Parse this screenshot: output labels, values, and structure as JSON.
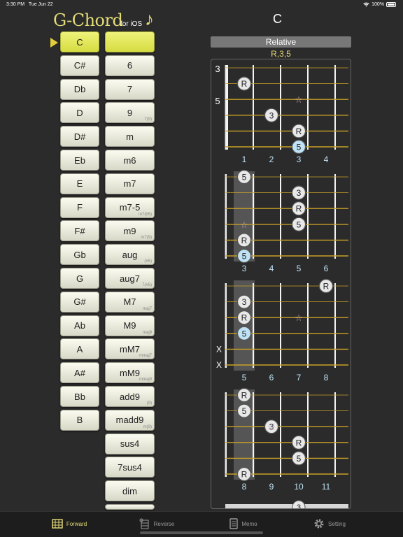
{
  "status_bar": {
    "time": "3:30 PM",
    "date": "Tue Jun 22",
    "battery": "100%"
  },
  "app": {
    "logo": "G-Chord",
    "logo_sub": "for iOS",
    "logo_note": "♪"
  },
  "selected_chord": "C",
  "roots": [
    "C",
    "C#",
    "Db",
    "D",
    "D#",
    "Eb",
    "E",
    "F",
    "F#",
    "Gb",
    "G",
    "G#",
    "Ab",
    "A",
    "A#",
    "Bb",
    "B"
  ],
  "types": [
    {
      "label": "",
      "sub": ""
    },
    {
      "label": "6",
      "sub": ""
    },
    {
      "label": "7",
      "sub": ""
    },
    {
      "label": "9",
      "sub": "7(9)"
    },
    {
      "label": "m",
      "sub": ""
    },
    {
      "label": "m6",
      "sub": ""
    },
    {
      "label": "m7",
      "sub": ""
    },
    {
      "label": "m7-5",
      "sub": "m7(b5)"
    },
    {
      "label": "m9",
      "sub": "m7(9)"
    },
    {
      "label": "aug",
      "sub": "(#5)"
    },
    {
      "label": "aug7",
      "sub": "7(#5)"
    },
    {
      "label": "M7",
      "sub": "maj7"
    },
    {
      "label": "M9",
      "sub": "maj9"
    },
    {
      "label": "mM7",
      "sub": "mmaj7"
    },
    {
      "label": "mM9",
      "sub": "mmaj9"
    },
    {
      "label": "add9",
      "sub": "(9)"
    },
    {
      "label": "madd9",
      "sub": "m(9)"
    },
    {
      "label": "sus4",
      "sub": ""
    },
    {
      "label": "7sus4",
      "sub": ""
    },
    {
      "label": "dim",
      "sub": ""
    },
    {
      "label": "",
      "sub": ""
    }
  ],
  "relative": {
    "label": "Relative",
    "formula": "R,3,5"
  },
  "diagrams": [
    {
      "start_fret_label": "3",
      "extra_label": "5",
      "frets": [
        "1",
        "2",
        "3",
        "4"
      ],
      "nut": true,
      "muted": [],
      "dots": [
        {
          "string": 1,
          "fret": 1,
          "text": "R",
          "style": "normal"
        },
        {
          "string": 3,
          "fret": 2,
          "text": "3",
          "style": "normal"
        },
        {
          "string": 2,
          "fret": 3,
          "text": "☆",
          "style": "star"
        },
        {
          "string": 4,
          "fret": 3,
          "text": "R",
          "style": "normal"
        },
        {
          "string": 5,
          "fret": 3,
          "text": "5",
          "style": "blue"
        }
      ]
    },
    {
      "frets": [
        "3",
        "4",
        "5",
        "6"
      ],
      "nut": false,
      "barre_fret": 1,
      "muted": [],
      "dots": [
        {
          "string": 0,
          "fret": 1,
          "text": "5",
          "style": "normal"
        },
        {
          "string": 1,
          "fret": 3,
          "text": "3",
          "style": "normal"
        },
        {
          "string": 2,
          "fret": 3,
          "text": "R",
          "style": "normal"
        },
        {
          "string": 3,
          "fret": 1,
          "text": "☆",
          "style": "star"
        },
        {
          "string": 3,
          "fret": 3,
          "text": "5",
          "style": "normal"
        },
        {
          "string": 4,
          "fret": 1,
          "text": "R",
          "style": "normal"
        },
        {
          "string": 5,
          "fret": 1,
          "text": "5",
          "style": "blue"
        }
      ]
    },
    {
      "frets": [
        "5",
        "6",
        "7",
        "8"
      ],
      "nut": false,
      "barre_fret": 1,
      "muted": [
        4,
        5
      ],
      "dots": [
        {
          "string": 0,
          "fret": 4,
          "text": "R",
          "style": "normal"
        },
        {
          "string": 1,
          "fret": 1,
          "text": "3",
          "style": "normal"
        },
        {
          "string": 2,
          "fret": 1,
          "text": "R",
          "style": "normal"
        },
        {
          "string": 2,
          "fret": 3,
          "text": "☆",
          "style": "star"
        },
        {
          "string": 3,
          "fret": 1,
          "text": "5",
          "style": "blue"
        }
      ]
    },
    {
      "frets": [
        "8",
        "9",
        "10",
        "11"
      ],
      "nut": false,
      "barre_fret": 1,
      "muted": [],
      "dots": [
        {
          "string": 0,
          "fret": 1,
          "text": "R",
          "style": "normal"
        },
        {
          "string": 1,
          "fret": 1,
          "text": "5",
          "style": "normal"
        },
        {
          "string": 2,
          "fret": 2,
          "text": "3",
          "style": "normal"
        },
        {
          "string": 2,
          "fret": 2,
          "text": "☆",
          "style": "star"
        },
        {
          "string": 3,
          "fret": 3,
          "text": "R",
          "style": "normal"
        },
        {
          "string": 4,
          "fret": 3,
          "text": "5",
          "style": "normal"
        },
        {
          "string": 5,
          "fret": 1,
          "text": "R",
          "style": "normal"
        }
      ]
    }
  ],
  "peek_dot": "3",
  "tabs": [
    {
      "label": "Forward",
      "icon": "guitar-neck-icon",
      "active": true
    },
    {
      "label": "Reverse",
      "icon": "reverse-search-icon",
      "active": false
    },
    {
      "label": "Memo",
      "icon": "memo-icon",
      "active": false
    },
    {
      "label": "Setting",
      "icon": "gear-icon",
      "active": false
    }
  ],
  "colors": {
    "accent": "#e3db78",
    "selected_button": "#e3e85a",
    "fret_wire": "#c9a227",
    "dot_blue": "#bfe3f5",
    "barre": "#555555"
  }
}
